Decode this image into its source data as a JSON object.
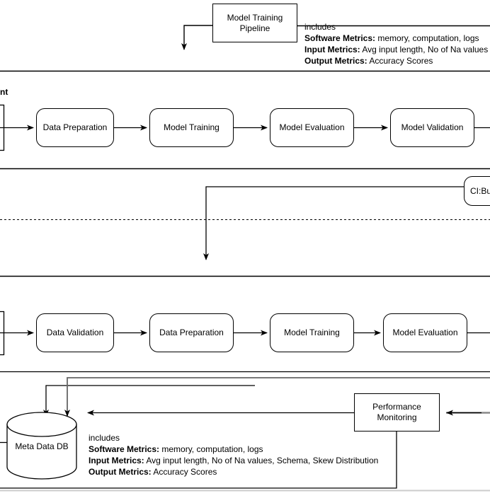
{
  "diagram": {
    "title_box": {
      "label": "Model Training\nPipeline",
      "line1": "Model Training",
      "line2": "Pipeline"
    },
    "cut_labels": {
      "left_top_partial": "nt"
    },
    "ci_box": {
      "label": "CI:Bu"
    },
    "legend_top": {
      "heading": "includes",
      "rows": [
        {
          "key": "Software Metrics:",
          "value": " memory, computation, logs"
        },
        {
          "key": "Input Metrics:",
          "value": " Avg input length, No of Na values"
        },
        {
          "key": "Output Metrics:",
          "value": " Accuracy Scores"
        }
      ]
    },
    "legend_bottom": {
      "heading": "includes",
      "rows": [
        {
          "key": "Software Metrics:",
          "value": " memory, computation, logs"
        },
        {
          "key": "Input Metrics:",
          "value": " Avg input length, No of Na values,  Schema, Skew Distribution"
        },
        {
          "key": "Output Metrics:",
          "value": " Accuracy Scores"
        }
      ]
    },
    "pipeline_top": {
      "steps": [
        {
          "label": "Data Preparation"
        },
        {
          "label": "Model Training"
        },
        {
          "label": "Model Evaluation"
        },
        {
          "label": "Model Validation"
        }
      ]
    },
    "pipeline_bottom": {
      "steps": [
        {
          "label": "Data Validation"
        },
        {
          "label": "Data Preparation"
        },
        {
          "label": "Model Training"
        },
        {
          "label": "Model Evaluation"
        }
      ]
    },
    "datastore": {
      "label": "Meta Data DB"
    },
    "monitoring": {
      "line1": "Performance",
      "line2": "Monitoring"
    },
    "colors": {
      "stroke": "#000000",
      "stroke_gray": "#666666",
      "background": "#ffffff",
      "panel_border": "#cccccc"
    }
  }
}
